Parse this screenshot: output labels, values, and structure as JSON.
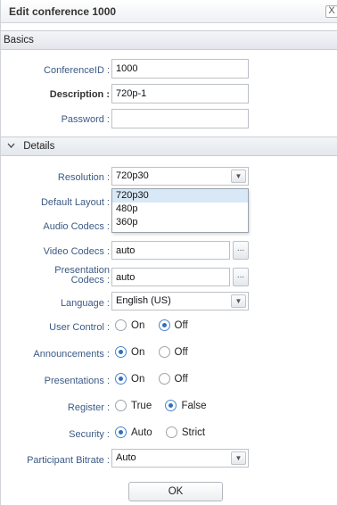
{
  "dialog": {
    "title": "Edit conference 1000",
    "close_glyph": "X"
  },
  "basics": {
    "section_label": "Basics",
    "conference_id": {
      "label": "ConferenceID :",
      "value": "1000"
    },
    "description": {
      "label": "Description :",
      "value": "720p-1"
    },
    "password": {
      "label": "Password :",
      "value": ""
    }
  },
  "details": {
    "section_label": "Details",
    "resolution": {
      "label": "Resolution :",
      "value": "720p30",
      "options": [
        "720p30",
        "480p",
        "360p"
      ]
    },
    "default_layout": {
      "label": "Default Layout :"
    },
    "audio_codecs": {
      "label": "Audio Codecs :"
    },
    "video_codecs": {
      "label": "Video Codecs :",
      "value": "auto",
      "button": "..."
    },
    "presentation_codecs": {
      "label_line1": "Presentation",
      "label_line2": "Codecs :",
      "value": "auto",
      "button": "..."
    },
    "language": {
      "label": "Language :",
      "value": "English (US)"
    },
    "user_control": {
      "label": "User Control :",
      "options": [
        "On",
        "Off"
      ],
      "selected": "Off"
    },
    "announcements": {
      "label": "Announcements :",
      "options": [
        "On",
        "Off"
      ],
      "selected": "On"
    },
    "presentations": {
      "label": "Presentations :",
      "options": [
        "On",
        "Off"
      ],
      "selected": "On"
    },
    "register": {
      "label": "Register :",
      "options": [
        "True",
        "False"
      ],
      "selected": "False"
    },
    "security": {
      "label": "Security :",
      "options": [
        "Auto",
        "Strict"
      ],
      "selected": "Auto"
    },
    "participant_bitrate": {
      "label": "Participant Bitrate :",
      "value": "Auto"
    }
  },
  "ok_label": "OK",
  "icons": {
    "chevron": "chevron-down-icon",
    "select_arrow": "dropdown-arrow-icon"
  }
}
